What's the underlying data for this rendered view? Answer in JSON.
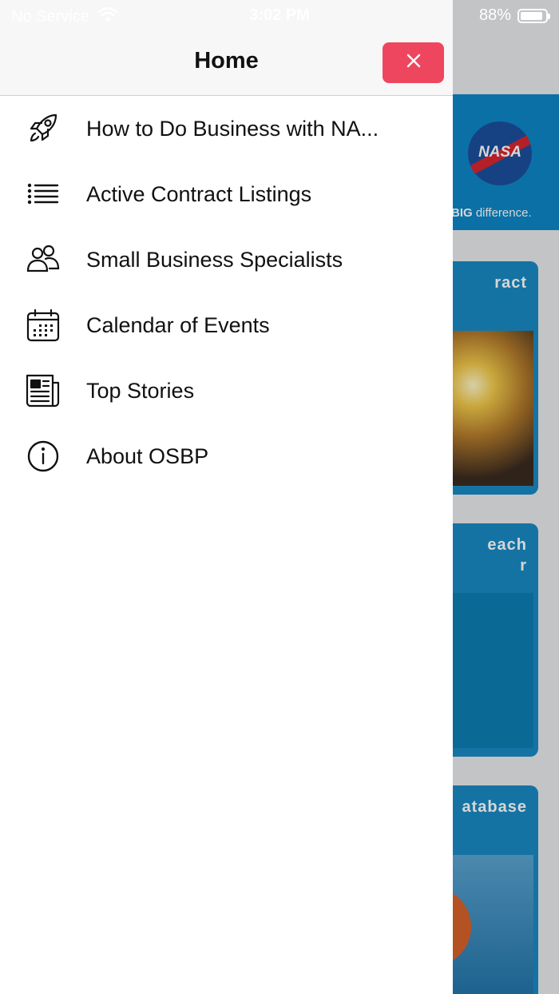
{
  "status_bar": {
    "carrier": "No Service",
    "time": "3:02 PM",
    "battery": "88%",
    "battery_level": 0.88
  },
  "drawer": {
    "title": "Home",
    "close_icon": "close-icon",
    "items": [
      {
        "label": "How to Do Business with NA...",
        "icon": "rocket-icon"
      },
      {
        "label": "Active Contract Listings",
        "icon": "list-icon"
      },
      {
        "label": "Small Business Specialists",
        "icon": "people-icon"
      },
      {
        "label": "Calendar of Events",
        "icon": "calendar-icon"
      },
      {
        "label": "Top Stories",
        "icon": "newspaper-icon"
      },
      {
        "label": "About OSBP",
        "icon": "info-icon"
      }
    ]
  },
  "background": {
    "logo_text": "NASA",
    "tagline_bold": "BIG",
    "tagline_rest": " difference.",
    "cards": [
      {
        "title": "ract"
      },
      {
        "title": "each\nr"
      },
      {
        "title": "atabase"
      }
    ]
  },
  "colors": {
    "close_button": "#ef4660",
    "banner": "#0e86c6",
    "card": "#1a8ac4"
  }
}
